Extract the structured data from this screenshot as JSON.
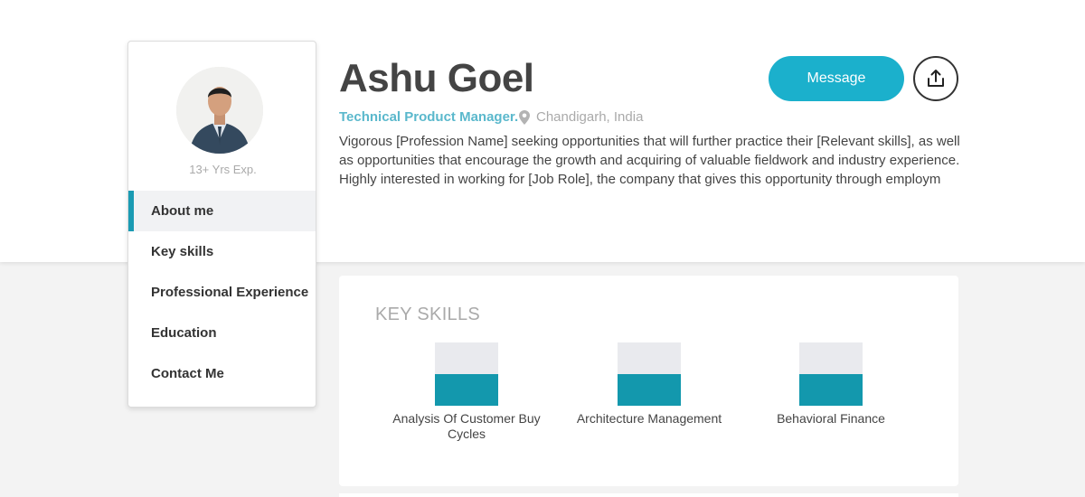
{
  "profile": {
    "name": "Ashu Goel",
    "role": "Technical Product Manager.",
    "location": "Chandigarh, India",
    "experience": "13+ Yrs Exp.",
    "bio": "Vigorous [Profession Name] seeking opportunities that will further practice their [Relevant skills], as well as opportunities that encourage the growth and acquiring of valuable fieldwork and industry experience. Highly interested in working for [Job Role], the company that gives this opportunity through employm"
  },
  "actions": {
    "message_label": "Message",
    "share_icon": "share-upload-icon"
  },
  "sidebar": {
    "items": [
      {
        "label": "About me",
        "active": true
      },
      {
        "label": "Key skills",
        "active": false
      },
      {
        "label": "Professional Experience",
        "active": false
      },
      {
        "label": "Education",
        "active": false
      },
      {
        "label": "Contact Me",
        "active": false
      }
    ]
  },
  "skills": {
    "title": "KEY SKILLS",
    "items": [
      {
        "label": "Analysis Of Customer Buy Cycles",
        "level": 0.5
      },
      {
        "label": "Architecture Management",
        "level": 0.5
      },
      {
        "label": "Behavioral Finance",
        "level": 0.5
      }
    ]
  },
  "colors": {
    "accent": "#1bb0cc",
    "skill_fill": "#1398ad",
    "role_text": "#5ab8cc"
  }
}
